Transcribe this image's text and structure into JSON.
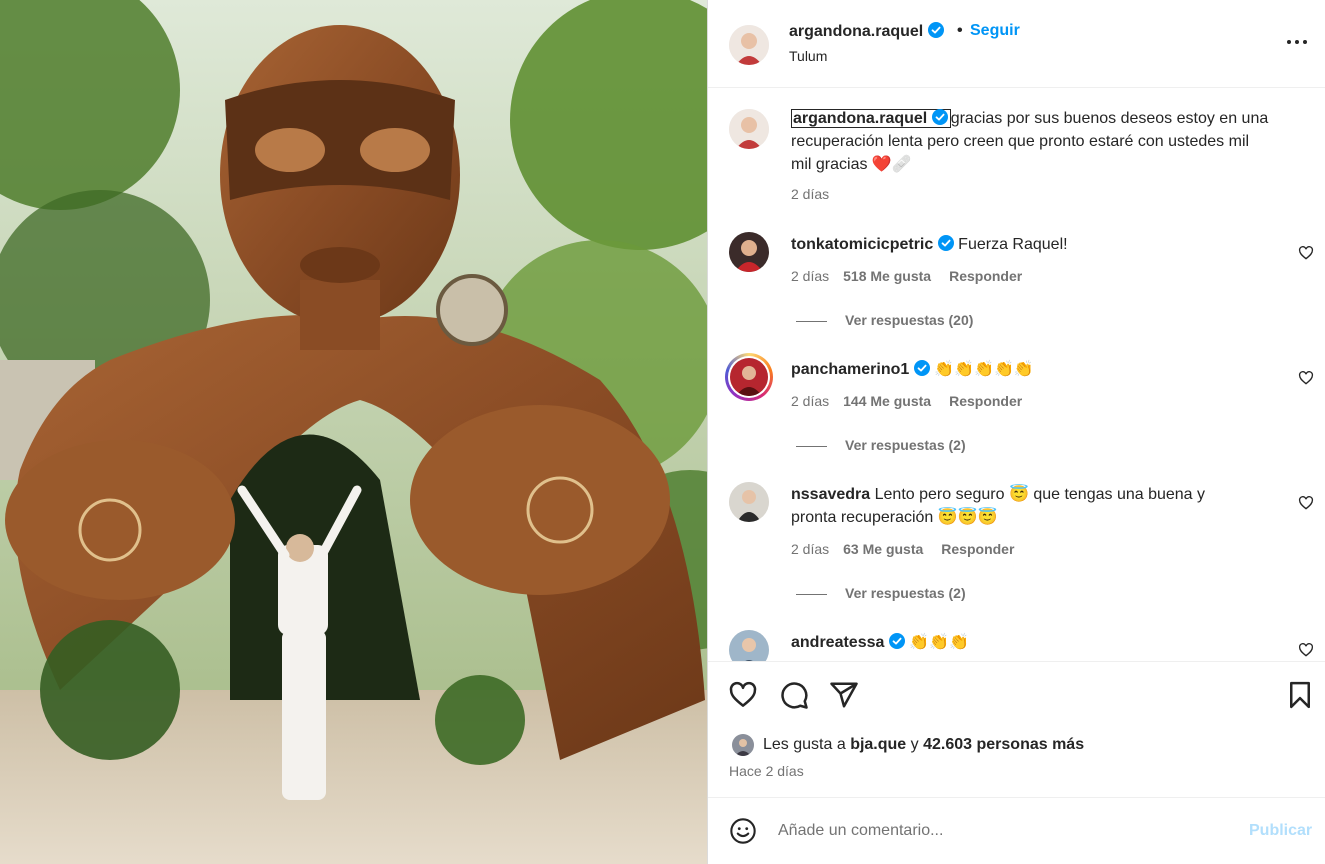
{
  "post": {
    "username": "argandona.raquel",
    "follow_label": "Seguir",
    "separator": "•",
    "location": "Tulum",
    "more_icon": "more-horizontal-icon"
  },
  "caption": {
    "username": "argandona.raquel",
    "text": "gracias por sus buenos deseos estoy en una",
    "text_line2": "recuperación lenta pero creen que pronto estaré con ustedes mil",
    "text_line3": "mil gracias",
    "emojis": "❤️🩹",
    "time": "2 días"
  },
  "comments": [
    {
      "username": "tonkatomicicpetric",
      "verified": true,
      "text": "Fuerza Raquel!",
      "time": "2 días",
      "likes": "518 Me gusta",
      "reply_label": "Responder",
      "view_replies": "Ver respuestas (20)"
    },
    {
      "username": "panchamerino1",
      "verified": true,
      "text": "👏👏👏👏👏",
      "time": "2 días",
      "likes": "144 Me gusta",
      "reply_label": "Responder",
      "view_replies": "Ver respuestas (2)"
    },
    {
      "username": "nssavedra",
      "verified": false,
      "text": "Lento pero seguro 😇 que tengas una buena y",
      "text_line2": "pronta recuperación 😇😇😇",
      "time": "2 días",
      "likes": "63 Me gusta",
      "reply_label": "Responder",
      "view_replies": "Ver respuestas (2)"
    },
    {
      "username": "andreatessa",
      "verified": true,
      "text": "👏👏👏"
    }
  ],
  "actions": {
    "like_icon": "heart-icon",
    "comment_icon": "comment-icon",
    "share_icon": "send-icon",
    "save_icon": "bookmark-icon"
  },
  "likes": {
    "prefix": "Les gusta a",
    "user": "bja.que",
    "middle": "y",
    "count": "42.603 personas más"
  },
  "posted": "Hace 2 días",
  "add_comment": {
    "placeholder": "Añade un comentario...",
    "publish_label": "Publicar"
  },
  "colors": {
    "accent": "#0095f6",
    "verified": "#0095f6",
    "publish_disabled": "#b2dffc",
    "muted": "#737373"
  }
}
